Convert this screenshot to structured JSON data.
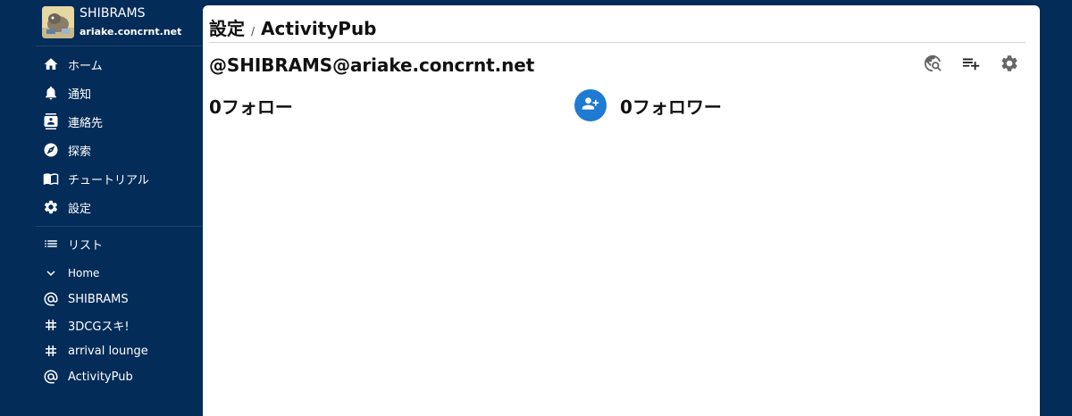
{
  "profile": {
    "name": "SHIBRAMS",
    "host": "ariake.concrnt.net"
  },
  "nav": {
    "home": "ホーム",
    "notifications": "通知",
    "contacts": "連絡先",
    "explore": "探索",
    "tutorial": "チュートリアル",
    "settings": "設定"
  },
  "lists": {
    "label": "リスト",
    "group": "Home",
    "items": [
      {
        "icon": "at-icon",
        "label": "SHIBRAMS"
      },
      {
        "icon": "hash-icon",
        "label": "3DCGスキ!"
      },
      {
        "icon": "hash-icon",
        "label": "arrival lounge"
      },
      {
        "icon": "at-icon",
        "label": "ActivityPub"
      }
    ]
  },
  "breadcrumb": {
    "parent": "設定",
    "separator": "/",
    "current": "ActivityPub"
  },
  "account": {
    "handle": "@SHIBRAMS@ariake.concrnt.net"
  },
  "toolbar": {
    "icons": [
      "travel-explore-icon",
      "playlist-add-icon",
      "gear-icon"
    ]
  },
  "stats": {
    "following": "0フォロー",
    "followers": "0フォロワー"
  },
  "colors": {
    "sidebar_bg": "#032c58",
    "panel_bg": "#ffffff",
    "accent": "#1e7ad2"
  }
}
